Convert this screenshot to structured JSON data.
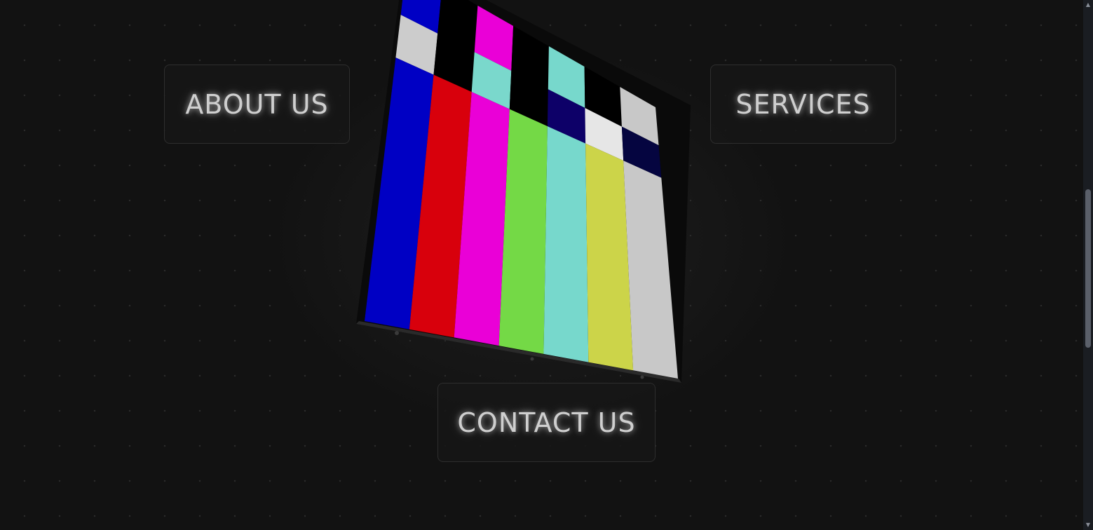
{
  "nav": {
    "about_label": "ABOUT US",
    "services_label": "SERVICES",
    "contact_label": "CONTACT US"
  },
  "tv": {
    "top_bars": [
      "#cccccc",
      "#000000",
      "#7ad8cc",
      "#000000",
      "#0d0068",
      "#e6e6e6",
      "#050540"
    ],
    "bars": [
      "#0000c4",
      "#d8000c",
      "#ea00d7",
      "#74d946",
      "#77d8cc",
      "#ccd449",
      "#c8c8c8"
    ],
    "bottom_bars": [
      "#0000c4",
      "#000000",
      "#ea00d7",
      "#000000",
      "#77d8cc",
      "#000000",
      "#c8c8c8"
    ]
  },
  "scrollbar": {
    "up_icon": "triangle-up-icon",
    "down_icon": "triangle-down-icon"
  }
}
